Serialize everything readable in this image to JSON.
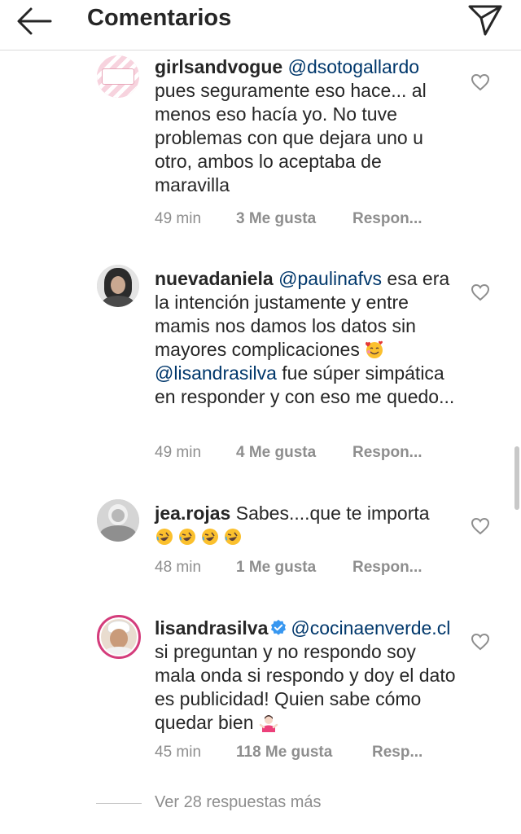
{
  "header": {
    "title": "Comentarios"
  },
  "comments": [
    {
      "username": "girlsandvogue",
      "mention": "@dsotogallardo",
      "text": " pues seguramente eso hace... al menos eso hacía yo. No tuve problemas con que dejara uno u otro, ambos lo aceptaba de maravilla",
      "time": "49 min",
      "likes": "3 Me gusta",
      "reply": "Respon..."
    },
    {
      "username": "nuevadaniela",
      "mention": "@paulinafvs",
      "text_1": " esa era la intención justamente y entre mamis nos damos los datos sin mayores complicaciones ",
      "mention_2": "@lisandrasilva",
      "text_2": " fue súper simpática en responder y con eso me quedo...",
      "time": "49 min",
      "likes": "4 Me gusta",
      "reply": "Respon..."
    },
    {
      "username": "jea.rojas",
      "text": " Sabes....que te importa",
      "emoji": "rolling-laughing-emoji x4",
      "time": "48 min",
      "likes": "1 Me gusta",
      "reply": "Respon..."
    },
    {
      "username": "lisandrasilva",
      "verified": true,
      "mention": "@cocinaenverde.cl",
      "text": " si preguntan y no respondo soy mala onda si respondo y doy el dato es publicidad! Quien sabe cómo quedar bien ",
      "time": "45 min",
      "likes": "118 Me gusta",
      "reply": "Resp..."
    }
  ],
  "footer": {
    "more_replies": "Ver 28 respuestas más"
  },
  "colors": {
    "mention": "#00376b",
    "meta": "#8e8e8e",
    "verified": "#3897f0",
    "ring": "#d43c7b"
  }
}
